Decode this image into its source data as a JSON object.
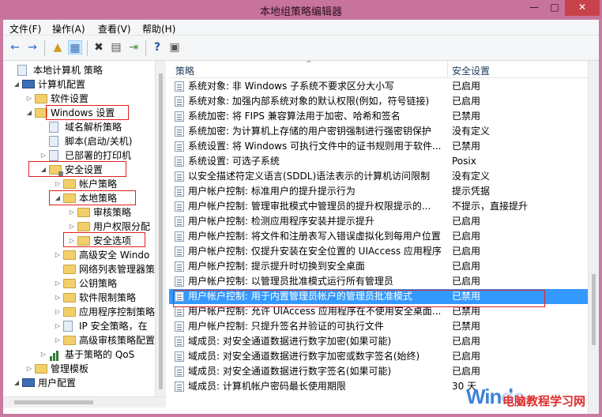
{
  "window": {
    "title": "本地组策略编辑器",
    "min_glyph": "—",
    "max_glyph": "□",
    "close_glyph": "✕"
  },
  "menubar": [
    {
      "label": "文件(F)"
    },
    {
      "label": "操作(A)"
    },
    {
      "label": "查看(V)"
    },
    {
      "label": "帮助(H)"
    }
  ],
  "toolbar": {
    "back": "←",
    "forward": "→",
    "up": "▲",
    "show_tree": "▦",
    "delete": "✖",
    "properties": "▤",
    "export": "⇥",
    "help": "?",
    "filter": "▣"
  },
  "tree": [
    {
      "label": "本地计算机 策略",
      "expander": "",
      "icon": "doc"
    },
    {
      "label": "计算机配置",
      "expander": "◢",
      "icon": "comp"
    },
    {
      "label": "软件设置",
      "expander": "▷",
      "icon": "folder"
    },
    {
      "label": "Windows 设置",
      "expander": "◢",
      "icon": "folder"
    },
    {
      "label": "域名解析策略",
      "expander": "",
      "icon": "doc"
    },
    {
      "label": "脚本(启动/关机)",
      "expander": "",
      "icon": "doc"
    },
    {
      "label": "已部署的打印机",
      "expander": "▷",
      "icon": "doc"
    },
    {
      "label": "安全设置",
      "expander": "◢",
      "icon": "folder lock"
    },
    {
      "label": "帐户策略",
      "expander": "▷",
      "icon": "folder"
    },
    {
      "label": "本地策略",
      "expander": "◢",
      "icon": "folder"
    },
    {
      "label": "审核策略",
      "expander": "▷",
      "icon": "folder"
    },
    {
      "label": "用户权限分配",
      "expander": "▷",
      "icon": "folder"
    },
    {
      "label": "安全选项",
      "expander": "▷",
      "icon": "folder"
    },
    {
      "label": "高级安全 Windo",
      "expander": "▷",
      "icon": "folder"
    },
    {
      "label": "网络列表管理器策",
      "expander": "",
      "icon": "folder"
    },
    {
      "label": "公钥策略",
      "expander": "▷",
      "icon": "folder"
    },
    {
      "label": "软件限制策略",
      "expander": "▷",
      "icon": "folder"
    },
    {
      "label": "应用程序控制策略",
      "expander": "▷",
      "icon": "folder"
    },
    {
      "label": "IP 安全策略，在",
      "expander": "▷",
      "icon": "doc"
    },
    {
      "label": "高级审核策略配置",
      "expander": "▷",
      "icon": "folder"
    },
    {
      "label": "基于策略的 QoS",
      "expander": "▷",
      "icon": "chart"
    },
    {
      "label": "管理模板",
      "expander": "▷",
      "icon": "folder"
    },
    {
      "label": "用户配置",
      "expander": "◢",
      "icon": "comp"
    }
  ],
  "list": {
    "col_policy": "策略",
    "col_setting": "安全设置",
    "sort_glyph": "^",
    "rows": [
      {
        "name": "系统对象: 非 Windows 子系统不要求区分大小写",
        "setting": "已启用"
      },
      {
        "name": "系统对象: 加强内部系统对象的默认权限(例如，符号链接)",
        "setting": "已启用"
      },
      {
        "name": "系统加密: 将 FIPS 兼容算法用于加密、哈希和签名",
        "setting": "已禁用"
      },
      {
        "name": "系统加密: 为计算机上存储的用户密钥强制进行强密钥保护",
        "setting": "没有定义"
      },
      {
        "name": "系统设置: 将 Windows 可执行文件中的证书规则用于软件...",
        "setting": "已禁用"
      },
      {
        "name": "系统设置: 可选子系统",
        "setting": "Posix"
      },
      {
        "name": "以安全描述符定义语言(SDDL)语法表示的计算机访问限制",
        "setting": "没有定义"
      },
      {
        "name": "用户帐户控制: 标准用户的提升提示行为",
        "setting": "提示凭据"
      },
      {
        "name": "用户帐户控制: 管理审批模式中管理员的提升权限提示的...",
        "setting": "不提示，直接提升"
      },
      {
        "name": "用户帐户控制: 检测应用程序安装并提示提升",
        "setting": "已启用"
      },
      {
        "name": "用户帐户控制: 将文件和注册表写入错误虚拟化到每用户位置",
        "setting": "已启用"
      },
      {
        "name": "用户帐户控制: 仅提升安装在安全位置的 UIAccess 应用程序",
        "setting": "已启用"
      },
      {
        "name": "用户帐户控制: 提示提升时切换到安全桌面",
        "setting": "已启用"
      },
      {
        "name": "用户帐户控制: 以管理员批准模式运行所有管理员",
        "setting": "已启用"
      },
      {
        "name": "用户帐户控制: 用于内置管理员帐户的管理员批准模式",
        "setting": "已禁用",
        "selected": true
      },
      {
        "name": "用户帐户控制: 允许 UIAccess 应用程序在不使用安全桌面...",
        "setting": "已禁用"
      },
      {
        "name": "用户帐户控制: 只提升签名并验证的可执行文件",
        "setting": "已禁用"
      },
      {
        "name": "域成员: 对安全通道数据进行数字加密(如果可能)",
        "setting": "已启用"
      },
      {
        "name": "域成员: 对安全通道数据进行数字加密或数字签名(始终)",
        "setting": "已启用"
      },
      {
        "name": "域成员: 对安全通道数据进行数字签名(如果可能)",
        "setting": "已启用"
      },
      {
        "name": "域成员: 计算机帐户密码最长使用期限",
        "setting": "30 天"
      }
    ]
  },
  "watermark": {
    "text1": "Windo",
    "text2": "电脑教程学习网"
  }
}
